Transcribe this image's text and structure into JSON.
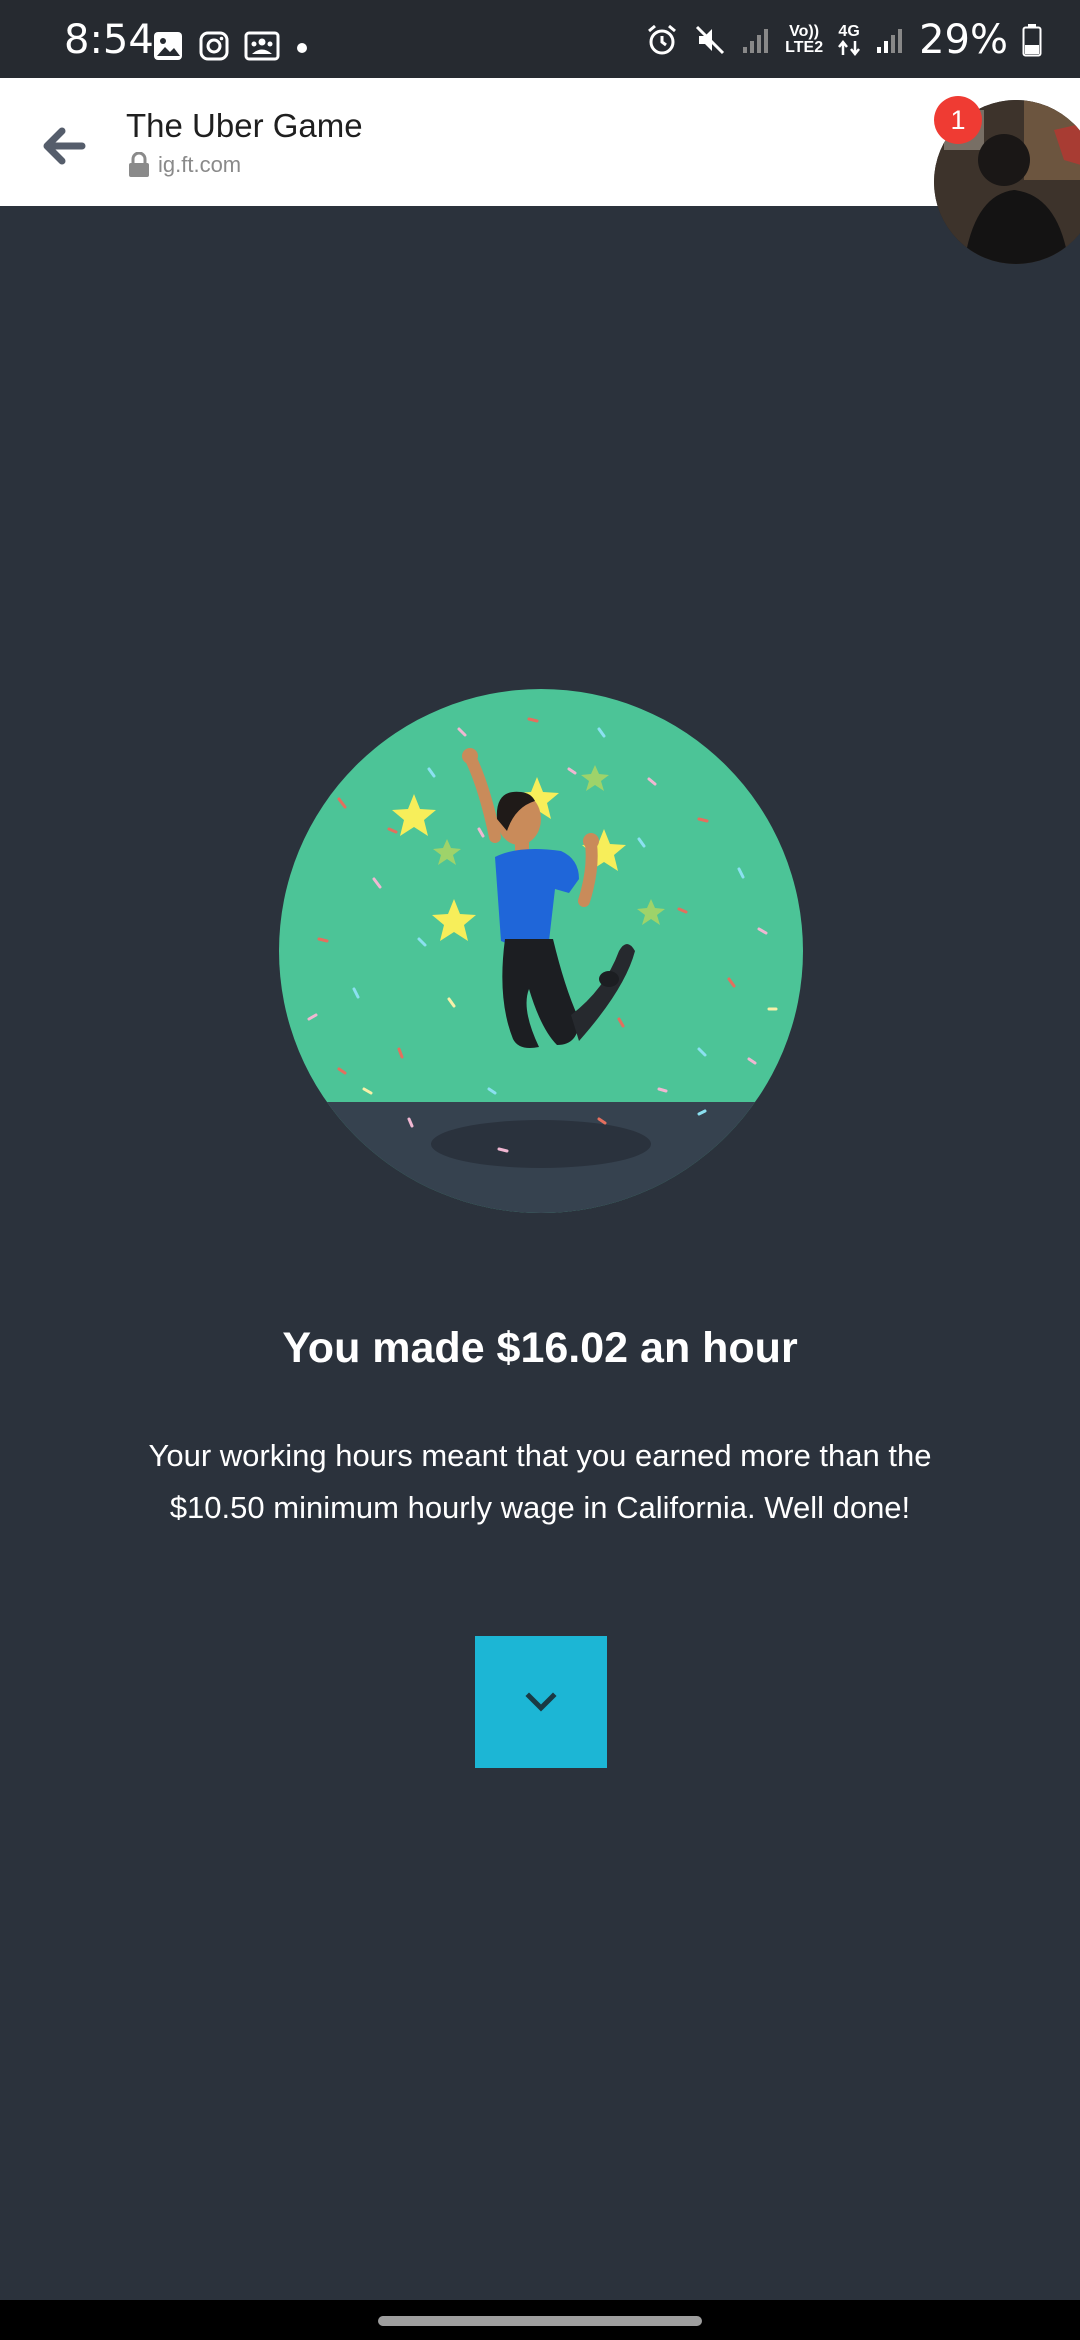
{
  "status_bar": {
    "time": "8:54",
    "network_label_top": "Vo))",
    "network_label_bottom": "LTE2",
    "network_type": "4G",
    "battery": "29%"
  },
  "browser": {
    "title": "The Uber Game",
    "url": "ig.ft.com",
    "notification_count": "1"
  },
  "content": {
    "headline": "You made $16.02 an hour",
    "body": "Your working hours meant that you earned more than the $10.50 minimum hourly wage in California. Well done!"
  },
  "colors": {
    "background": "#2b323c",
    "illustration_green": "#4cc497",
    "button": "#1cb6d5"
  },
  "icons": {
    "back": "arrow-left-icon",
    "lock": "lock-icon",
    "next": "chevron-down-icon"
  }
}
